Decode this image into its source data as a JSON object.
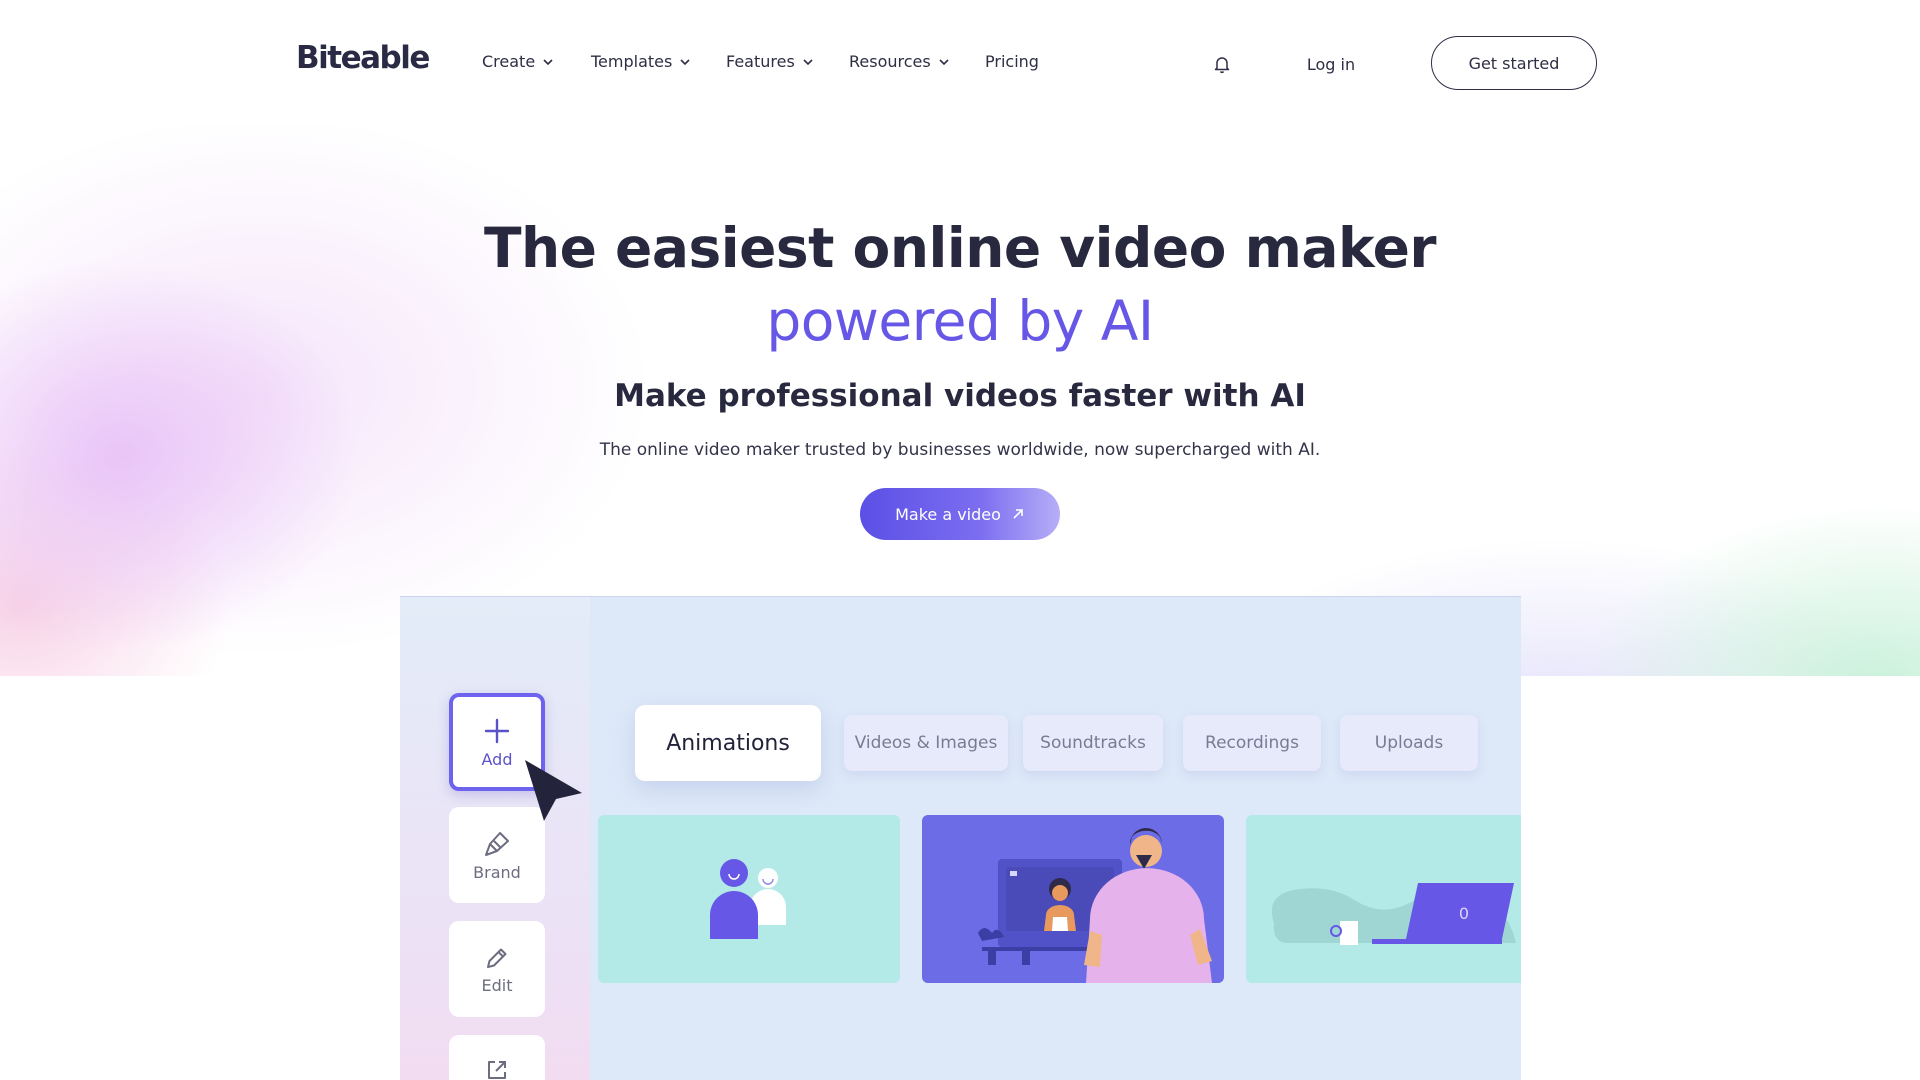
{
  "nav": {
    "logo": "Biteable",
    "items": [
      {
        "label": "Create",
        "has_dropdown": true
      },
      {
        "label": "Templates",
        "has_dropdown": true
      },
      {
        "label": "Features",
        "has_dropdown": true
      },
      {
        "label": "Resources",
        "has_dropdown": true
      },
      {
        "label": "Pricing",
        "has_dropdown": false
      }
    ],
    "bell_icon": "bell-icon",
    "login_label": "Log in",
    "get_started_label": "Get started"
  },
  "hero": {
    "title_line1": "The easiest online video maker",
    "title_line2": "powered by AI",
    "subtitle": "Make professional videos faster with AI",
    "lede": "The online video maker trusted by businesses worldwide, now supercharged with AI.",
    "cta_label": "Make a video",
    "cta_icon": "arrow-up-right-icon"
  },
  "mockup": {
    "side_buttons": [
      {
        "label": "Add",
        "icon": "plus-icon",
        "active": true
      },
      {
        "label": "Brand",
        "icon": "paint-brush-icon",
        "active": false
      },
      {
        "label": "Edit",
        "icon": "pencil-icon",
        "active": false
      },
      {
        "label": "",
        "icon": "share-icon",
        "active": false
      }
    ],
    "tabs": [
      {
        "label": "Animations",
        "active": true
      },
      {
        "label": "Videos & Images",
        "active": false
      },
      {
        "label": "Soundtracks",
        "active": false
      },
      {
        "label": "Recordings",
        "active": false
      },
      {
        "label": "Uploads",
        "active": false
      }
    ],
    "laptop_screen_text": "0"
  },
  "colors": {
    "accent": "#6657e6",
    "text_dark": "#28283f",
    "mock_bg": "#dde8f8",
    "card_teal": "#b3e9e7",
    "card_purple": "#6c6ce6"
  }
}
